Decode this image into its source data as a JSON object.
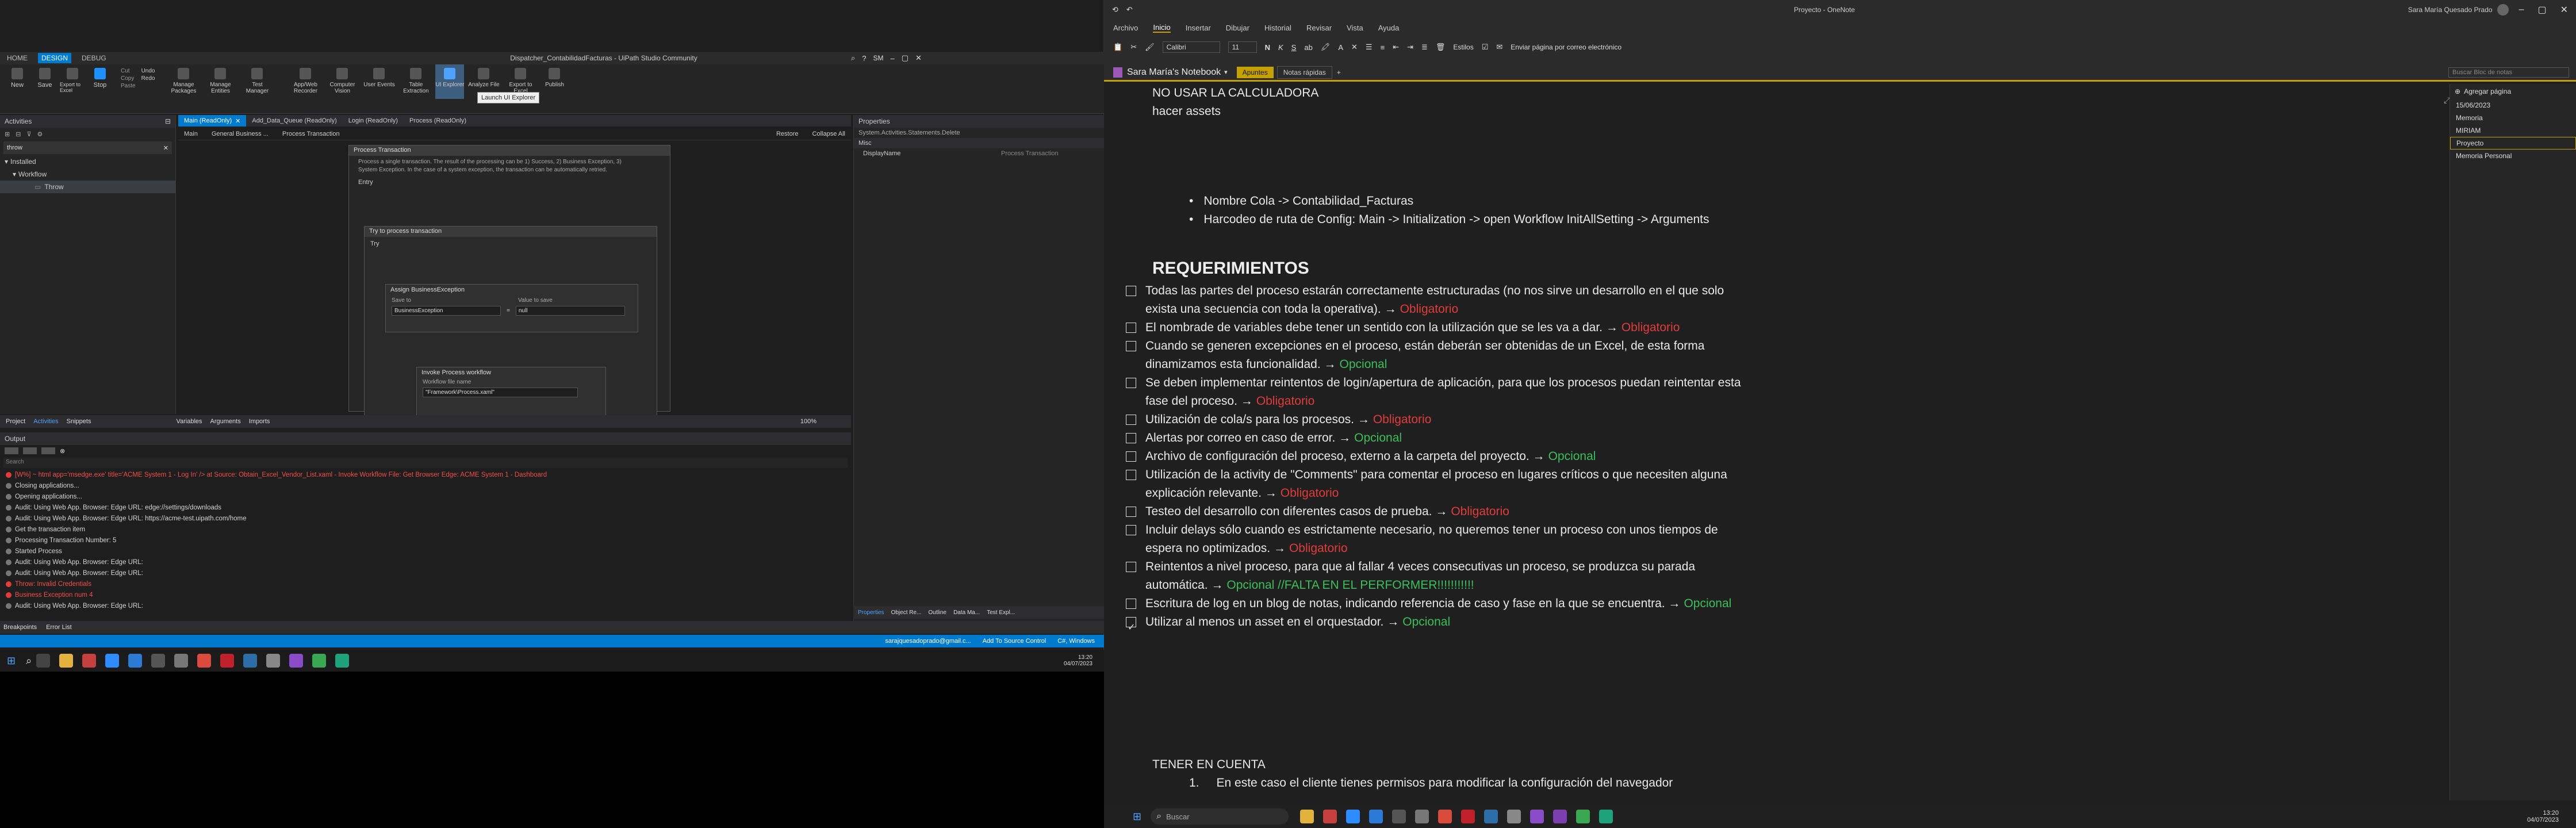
{
  "studio": {
    "menu_tabs": [
      "HOME",
      "DESIGN",
      "DEBUG"
    ],
    "window_title": "Dispatcher_ContabilidadFacturas - UiPath Studio Community",
    "user_initials": "SM",
    "ribbon_buttons": [
      "New",
      "Save",
      "Export to Excel",
      "Stop",
      "Cut",
      "Copy",
      "Paste",
      "Undo",
      "Redo",
      "Manage Packages",
      "Manage Entities",
      "Test Manager",
      "App/Web Recorder",
      "Computer Vision",
      "User Events",
      "Table Extraction",
      "UI Explorer",
      "Analyze File",
      "Export to Excel",
      "Publish"
    ],
    "tooltip": "Launch UI Explorer",
    "activities_panel": {
      "title": "Activities",
      "search_value": "throw",
      "tree": [
        "Installed",
        "Workflow",
        "Throw"
      ]
    },
    "doc_tabs": [
      "Main (ReadOnly)",
      "Add_Data_Queue (ReadOnly)",
      "Login (ReadOnly)",
      "Process (ReadOnly)"
    ],
    "breadcrumb": [
      "Main",
      "General Business ...",
      "Process Transaction"
    ],
    "breadcrumb_actions": [
      "Restore",
      "Collapse All"
    ],
    "process_card": {
      "title": "Process Transaction",
      "description": "Process a single transaction. The result of the processing can be 1) Success, 2) Business Exception, 3) System Exception. In the case of a system exception, the transaction can be automatically retried.",
      "entry": "Entry",
      "try_title": "Try to process transaction",
      "try_label": "Try",
      "assign_title": "Assign BusinessException",
      "save_to_label": "Save to",
      "value_label": "Value to save",
      "save_to_value": "BusinessException",
      "value_value": "null",
      "invoke_title": "Invoke Process workflow",
      "workflow_label": "Workflow file name",
      "workflow_value": "\"Framework\\Process.xaml\""
    },
    "bottom_left_tabs": [
      "Project",
      "Activities",
      "Snippets"
    ],
    "designer_tabs": [
      "Variables",
      "Arguments",
      "Imports"
    ],
    "zoom": "100%",
    "properties": {
      "title": "Properties",
      "type": "System.Activities.Statements.Delete",
      "section": "Misc",
      "row_label": "DisplayName",
      "row_value": "Process Transaction"
    },
    "right_tabs": [
      "Properties",
      "Object Re...",
      "Outline",
      "Data Ma...",
      "Test Expl..."
    ],
    "output": {
      "title": "Output",
      "search_placeholder": "Search",
      "lines": [
        {
          "text": "[W%] ~ html app='msedge.exe' title='ACME System 1 - Log In' /> at Source: Obtain_Excel_Vendor_List.xaml - Invoke Workflow File: Get Browser Edge: ACME System 1 - Dashboard",
          "level": "error"
        },
        {
          "text": "Closing applications...",
          "level": "info"
        },
        {
          "text": "Opening applications...",
          "level": "info"
        },
        {
          "text": "Audit: Using Web App. Browser: Edge URL: edge://settings/downloads",
          "level": "info"
        },
        {
          "text": "Audit: Using Web App. Browser: Edge URL: https://acme-test.uipath.com/home",
          "level": "info"
        },
        {
          "text": "Get the transaction item",
          "level": "info"
        },
        {
          "text": "Processing Transaction Number: 5",
          "level": "info"
        },
        {
          "text": "Started Process",
          "level": "info"
        },
        {
          "text": "Audit: Using Web App. Browser: Edge URL:",
          "level": "info"
        },
        {
          "text": "Audit: Using Web App. Browser: Edge URL:",
          "level": "info"
        },
        {
          "text": "Throw: Invalid Credentials",
          "level": "error"
        },
        {
          "text": "Business Exception num 4",
          "level": "error"
        },
        {
          "text": "Audit: Using Web App. Browser: Edge URL:",
          "level": "info"
        }
      ]
    },
    "bottom_tabs": [
      "Breakpoints",
      "Error List"
    ],
    "statusbar": {
      "user": "sarajquesadoprado@gmail.c...",
      "source_control": "Add To Source Control",
      "platform": "C#, Windows"
    },
    "clock": {
      "time": "13:20",
      "date": "04/07/2023"
    }
  },
  "onenote": {
    "window_title": "Proyecto - OneNote",
    "user": "Sara María Quesado Prado",
    "menu": [
      "Archivo",
      "Inicio",
      "Insertar",
      "Dibujar",
      "Historial",
      "Revisar",
      "Vista",
      "Ayuda"
    ],
    "font_name": "Calibri",
    "font_size": "11",
    "styles_label": "Estilos",
    "email_label": "Enviar página por correo electrónico",
    "notebook": "Sara María's Notebook",
    "sections": [
      "Apuntes",
      "Notas rápidas",
      "+"
    ],
    "search_placeholder": "Buscar Bloc de notas",
    "add_page": "Agregar página",
    "pages": [
      "15/06/2023",
      "Memoria",
      "MIRIAM",
      "Proyecto",
      "Memoria Personal"
    ],
    "top_lines": [
      "NO USAR LA CALCULADORA",
      "hacer assets"
    ],
    "bullets": [
      "Nombre Cola -> Contabilidad_Facturas",
      "Harcodeo de ruta de Config: Main -> Initialization -> open Workflow InitAllSetting -> Arguments"
    ],
    "requirements_title": "REQUERIMIENTOS",
    "requirements": [
      {
        "text": "Todas las partes del proceso estarán correctamente estructuradas (no nos sirve un desarrollo en el que solo exista una secuencia con toda la operativa). →",
        "tag": "Obligatorio",
        "tag_type": "red",
        "checked": false
      },
      {
        "text": "El nombrade de variables debe tener un sentido con la utilización que se les va a dar. →",
        "tag": "Obligatorio",
        "tag_type": "red",
        "checked": false
      },
      {
        "text": "Cuando se generen excepciones en el proceso, están deberán ser obtenidas de un Excel, de esta forma dinamizamos esta funcionalidad. →",
        "tag": "Opcional",
        "tag_type": "green",
        "checked": false
      },
      {
        "text": "Se deben implementar reintentos de login/apertura de aplicación, para que los procesos puedan reintentar esta fase del proceso. →",
        "tag": "Obligatorio",
        "tag_type": "red",
        "checked": false
      },
      {
        "text": "Utilización de cola/s para los procesos. →",
        "tag": "Obligatorio",
        "tag_type": "red",
        "checked": false
      },
      {
        "text": "Alertas por correo en caso de error. →",
        "tag": "Opcional",
        "tag_type": "green",
        "checked": false
      },
      {
        "text": "Archivo de configuración del proceso, externo a la carpeta del proyecto. →",
        "tag": "Opcional",
        "tag_type": "green",
        "checked": false
      },
      {
        "text": "Utilización de la activity de \"Comments\" para comentar el proceso en lugares críticos o que necesiten alguna explicación relevante. →",
        "tag": "Obligatorio",
        "tag_type": "red",
        "checked": false
      },
      {
        "text": "Testeo del desarrollo con diferentes casos de prueba. →",
        "tag": "Obligatorio",
        "tag_type": "red",
        "checked": false
      },
      {
        "text": "Incluir delays sólo cuando es estrictamente necesario, no queremos tener un proceso con unos tiempos de espera no optimizados. →",
        "tag": "Obligatorio",
        "tag_type": "red",
        "checked": false
      },
      {
        "text": "Reintentos a nivel proceso, para que al fallar 4 veces consecutivas un proceso, se produzca su parada automática. →",
        "tag": "Opcional //FALTA EN EL PERFORMER!!!!!!!!!!!",
        "tag_type": "green",
        "checked": false
      },
      {
        "text": "Escritura de log en un blog de notas, indicando referencia de caso y fase en la que se encuentra. →",
        "tag": "Opcional",
        "tag_type": "green",
        "checked": false
      },
      {
        "text": "Utilizar al menos un asset en el orquestador. →",
        "tag": "Opcional",
        "tag_type": "green",
        "checked": true
      }
    ],
    "tener_title": "TENER EN CUENTA",
    "tener_items": [
      "En este caso el cliente tienes permisos para modificar la configuración del navegador"
    ],
    "taskbar_search": "Buscar",
    "clock": {
      "time": "13:20",
      "date": "04/07/2023"
    }
  },
  "colors": {
    "accent_blue": "#007acc",
    "onenote_gold": "#c6a000",
    "required_red": "#e23b3b",
    "optional_green": "#3bbf5a"
  }
}
